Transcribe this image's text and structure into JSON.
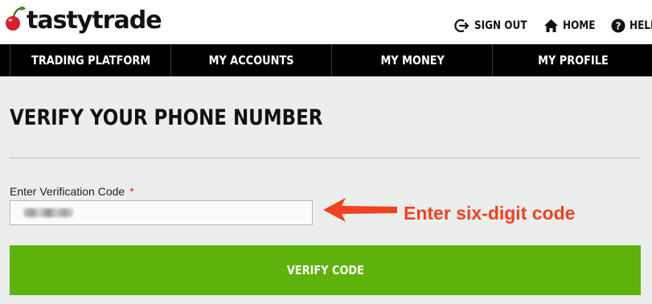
{
  "brand": {
    "name": "tastytrade",
    "accent_color": "#d5202d"
  },
  "utility_nav": [
    {
      "label": "SIGN OUT",
      "icon": "sign-out-icon"
    },
    {
      "label": "HOME",
      "icon": "home-icon"
    },
    {
      "label": "HELP",
      "icon": "help-icon"
    }
  ],
  "main_nav": [
    {
      "label": "TRADING PLATFORM"
    },
    {
      "label": "MY ACCOUNTS"
    },
    {
      "label": "MY MONEY"
    },
    {
      "label": "MY PROFILE"
    }
  ],
  "page": {
    "title": "VERIFY YOUR PHONE NUMBER",
    "field_label": "Enter Verification Code",
    "required_marker": "*",
    "code_input_value": "",
    "verify_button": "VERIFY CODE",
    "button_color": "#5db30b"
  },
  "annotation": {
    "text": "Enter six-digit code",
    "color": "#f0421f"
  }
}
